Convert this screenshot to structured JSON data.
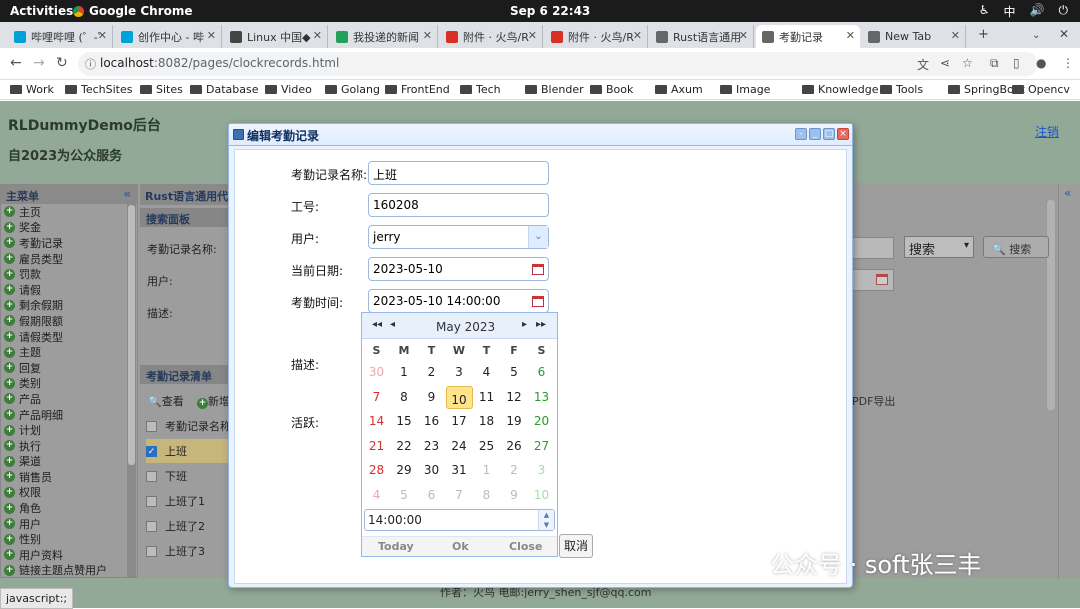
{
  "gnome": {
    "activities": "Activities",
    "app": "Google Chrome",
    "clock": "Sep 6  22:43",
    "input_method": "中"
  },
  "tabs": [
    {
      "label": "哔哩哔哩 (゜-゜",
      "color": "#00a1d6"
    },
    {
      "label": "创作中心 - 哔",
      "color": "#00a1d6"
    },
    {
      "label": "Linux 中国◆",
      "color": "#444444"
    },
    {
      "label": "我投递的新闻",
      "color": "#22a05a"
    },
    {
      "label": "附件 · 火鸟/R",
      "color": "#d93025"
    },
    {
      "label": "附件 · 火鸟/R",
      "color": "#d93025"
    },
    {
      "label": "Rust语言通用",
      "color": "#666666"
    },
    {
      "label": "考勤记录",
      "color": "#666666"
    },
    {
      "label": "New Tab",
      "color": "#666666"
    }
  ],
  "address": {
    "domain": "localhost",
    "path": ":8082/pages/clockrecords.html"
  },
  "bookmarks": [
    "Work",
    "TechSites",
    "Sites",
    "Database",
    "Video",
    "Golang",
    "FrontEnd",
    "Tech",
    "Blender",
    "Book",
    "Axum",
    "Image",
    "Knowledge",
    "Tools",
    "SpringBoot",
    "Opencv"
  ],
  "header": {
    "title": "RLDummyDemo后台",
    "subtitle": "自2023为公众服务",
    "logout": "注销"
  },
  "sidebar": {
    "title": "主菜单",
    "items": [
      "主页",
      "奖金",
      "考勤记录",
      "雇员类型",
      "罚款",
      "请假",
      "剩余假期",
      "假期限额",
      "请假类型",
      "主题",
      "回复",
      "类别",
      "产品",
      "产品明细",
      "计划",
      "执行",
      "渠道",
      "销售员",
      "权限",
      "角色",
      "用户",
      "性别",
      "用户资料",
      "链接主题点赞用户"
    ]
  },
  "main": {
    "tab": "Rust语言通用代码",
    "search_panel": "搜索面板",
    "search_labels": [
      "考勤记录名称:",
      "用户:",
      "描述:"
    ],
    "search_select": "搜索",
    "search_button": "搜索",
    "list_title": "考勤记录清单",
    "toolbar": {
      "view": "查看",
      "add": "新增",
      "pdf": "PDF导出"
    },
    "column": "考勤记录名称",
    "rows": [
      {
        "name": "上班",
        "checked": true
      },
      {
        "name": "下班",
        "checked": false
      },
      {
        "name": "上班了1",
        "checked": false
      },
      {
        "name": "上班了2",
        "checked": false
      },
      {
        "name": "上班了3",
        "checked": false
      }
    ]
  },
  "footer": {
    "text": "作者：火鸟 电邮:jerry_shen_sjf@qq.com"
  },
  "status": "javascript:;",
  "dialog": {
    "title": "编辑考勤记录",
    "fields": [
      {
        "label": "考勤记录名称:",
        "value": "上班"
      },
      {
        "label": "工号:",
        "value": "160208"
      },
      {
        "label": "用户:",
        "value": "jerry"
      },
      {
        "label": "当前日期:",
        "value": "2023-05-10"
      },
      {
        "label": "考勤时间:",
        "value": "2023-05-10 14:00:00"
      }
    ],
    "desc_label": "描述:",
    "active_label": "活跃:",
    "cancel": "取消"
  },
  "calendar": {
    "month": "May 2023",
    "weekdays": [
      "S",
      "M",
      "T",
      "W",
      "T",
      "F",
      "S"
    ],
    "weeks": [
      [
        "30",
        "1",
        "2",
        "3",
        "4",
        "5",
        "6"
      ],
      [
        "7",
        "8",
        "9",
        "10",
        "11",
        "12",
        "13"
      ],
      [
        "14",
        "15",
        "16",
        "17",
        "18",
        "19",
        "20"
      ],
      [
        "21",
        "22",
        "23",
        "24",
        "25",
        "26",
        "27"
      ],
      [
        "28",
        "29",
        "30",
        "31",
        "1",
        "2",
        "3"
      ],
      [
        "4",
        "5",
        "6",
        "7",
        "8",
        "9",
        "10"
      ]
    ],
    "other_month_cells": [
      [
        0,
        0
      ],
      [
        4,
        4
      ],
      [
        4,
        5
      ],
      [
        4,
        6
      ],
      [
        5,
        0
      ],
      [
        5,
        1
      ],
      [
        5,
        2
      ],
      [
        5,
        3
      ],
      [
        5,
        4
      ],
      [
        5,
        5
      ],
      [
        5,
        6
      ]
    ],
    "selected": [
      1,
      3
    ],
    "time": "14:00:00",
    "buttons": [
      "Today",
      "Ok",
      "Close"
    ]
  },
  "watermark": "公众号 · soft张三丰"
}
